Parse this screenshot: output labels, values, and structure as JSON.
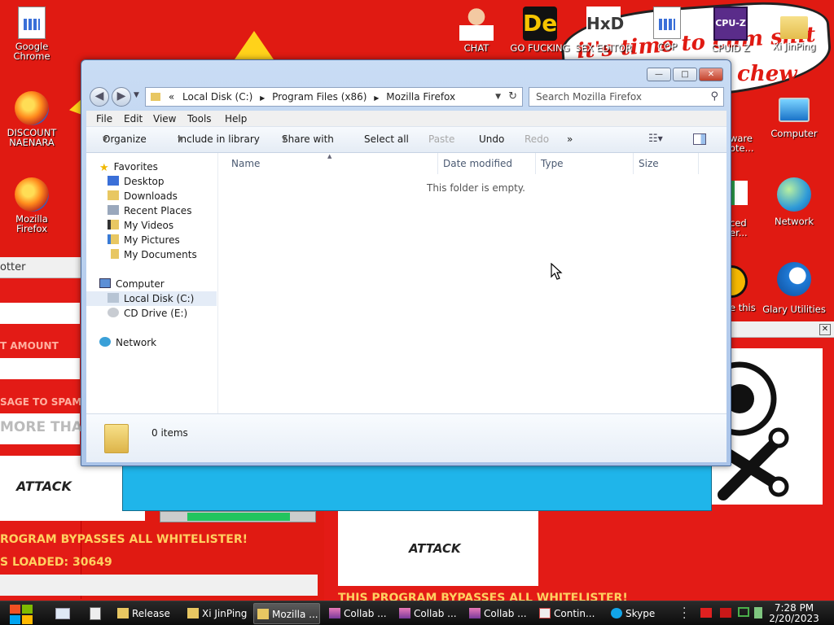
{
  "desktop": {
    "icons": {
      "chrome": "Google Chrome",
      "discount": "DISCOUNT NAENARA",
      "firefox": "Mozilla Firefox",
      "chat": "CHAT",
      "gofucking": "GO FUCKING",
      "hxd": "SEX EDITOR",
      "cop": "COP",
      "cpuz": "CPUID Z",
      "xijinping": "Xi JinPing",
      "computer": "Computer",
      "network": "Network",
      "glary": "Glary Utilities",
      "malware": "ware",
      "malware2": "ote...",
      "advanced": "ced",
      "advanced2": "er...",
      "pastethis": "e this"
    },
    "cpu_badge": "CPU-Z",
    "de_badge": "De",
    "hxd_badge": "HxD"
  },
  "background": {
    "banner": "it's time to cum shit",
    "banner2": "chew",
    "left_title": "otter",
    "amount": "T AMOUNT",
    "message": "SAGE TO SPAM",
    "more": "MORE THAN",
    "attack1": "ATTACK",
    "bypass1": "ROGRAM BYPASSES ALL WHITELISTER!",
    "loaded": "S LOADED: 30649",
    "attack2": "ATTACK",
    "bypass2": "THIS PROGRAM BYPASSES ALL WHITELISTER!"
  },
  "window": {
    "minimize": "—",
    "maximize": "□",
    "close": "✕",
    "address": {
      "prefix": "«",
      "crumbs": [
        "Local Disk (C:)",
        "Program Files (x86)",
        "Mozilla Firefox"
      ]
    },
    "search_placeholder": "Search Mozilla Firefox",
    "menu": [
      "File",
      "Edit",
      "View",
      "Tools",
      "Help"
    ],
    "toolbar": {
      "organize": "Organize",
      "include": "Include in library",
      "share": "Share with",
      "select_all": "Select all",
      "paste": "Paste",
      "undo": "Undo",
      "redo": "Redo",
      "more": "»"
    },
    "nav": {
      "favorites": "Favorites",
      "desktop": "Desktop",
      "downloads": "Downloads",
      "recent": "Recent Places",
      "videos": "My Videos",
      "pictures": "My Pictures",
      "documents": "My Documents",
      "computer": "Computer",
      "localdisk": "Local Disk (C:)",
      "cddrive": "CD Drive (E:)",
      "network": "Network"
    },
    "columns": [
      "Name",
      "Date modified",
      "Type",
      "Size"
    ],
    "empty_message": "This folder is empty.",
    "item_count": "0 items"
  },
  "taskbar": {
    "items": [
      "Release",
      "Xi JinPing",
      "Mozilla ...",
      "Collab ...",
      "Collab ...",
      "Collab ...",
      "Contin...",
      "Skype"
    ],
    "time": "7:28 PM",
    "date": "2/20/2023"
  },
  "colors": {
    "desktop_red": "#e01a12",
    "accent_blue": "#3a6fd8",
    "cyan_panel": "#1fb5ea"
  }
}
